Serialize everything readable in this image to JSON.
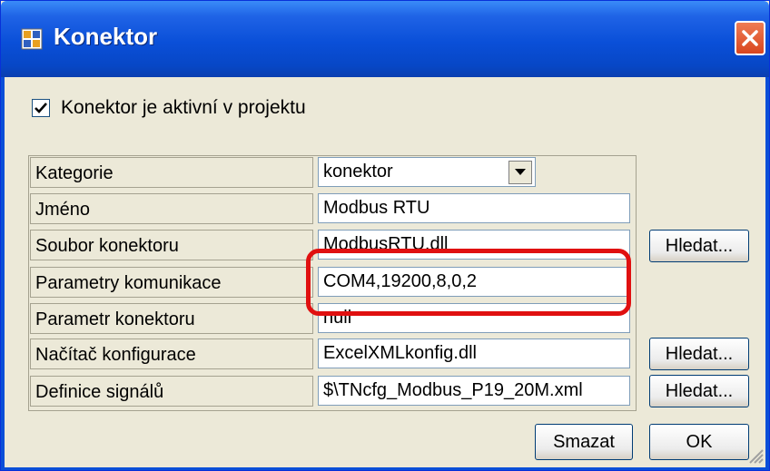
{
  "window": {
    "title": "Konektor",
    "close_icon": "close-icon",
    "app_icon": "window-app-icon"
  },
  "checkbox": {
    "label": "Konektor je aktivní v projektu",
    "checked": true
  },
  "rows": [
    {
      "label": "Kategorie",
      "value": "konektor",
      "type": "combo"
    },
    {
      "label": "Jméno",
      "value": "Modbus RTU",
      "type": "text"
    },
    {
      "label": "Soubor konektoru",
      "value": "ModbusRTU.dll",
      "type": "text",
      "button": "Hledat..."
    },
    {
      "label": "Parametry komunikace",
      "value": "COM4,19200,8,0,2",
      "type": "text"
    },
    {
      "label": "Parametr konektoru",
      "value": "null",
      "type": "text"
    },
    {
      "label": "Načítač konfigurace",
      "value": "ExcelXMLkonfig.dll",
      "type": "text",
      "button": "Hledat..."
    },
    {
      "label": "Definice signálů",
      "value": "$\\TNcfg_Modbus_P19_20M.xml",
      "type": "text",
      "button": "Hledat..."
    }
  ],
  "buttons": {
    "delete": "Smazat",
    "ok": "OK"
  },
  "colors": {
    "titlebar": "#0a4fd8",
    "highlight": "#e01010",
    "dialog_bg": "#ece9d8"
  }
}
